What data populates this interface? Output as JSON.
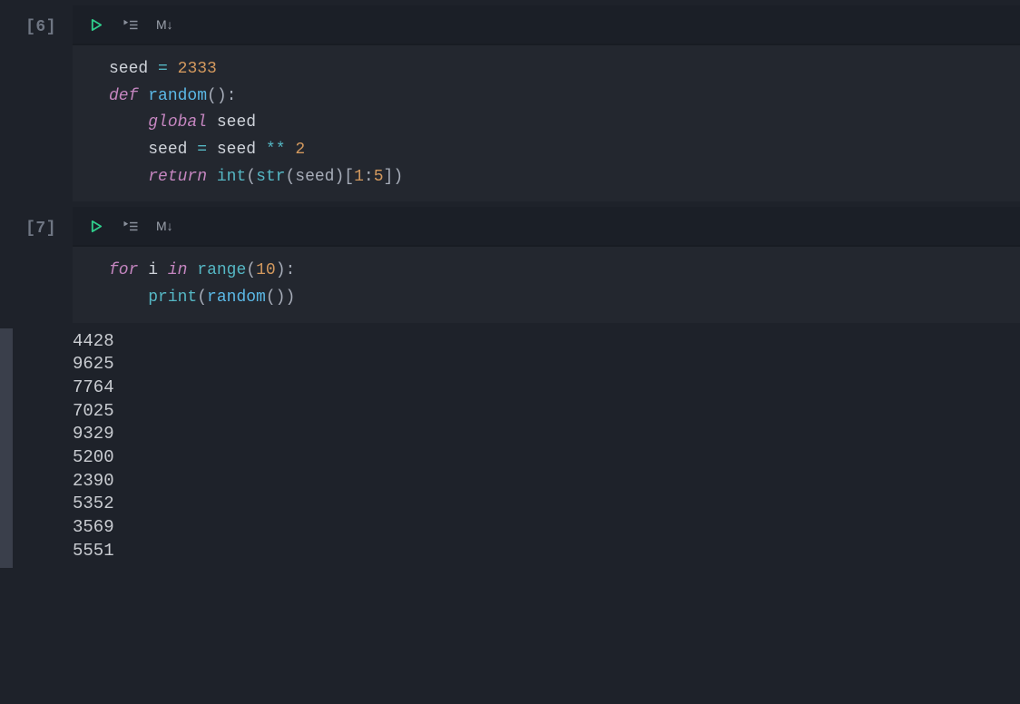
{
  "cells": [
    {
      "prompt": "[6]",
      "toolbar": {
        "markdown_label": "M↓"
      },
      "code_tokens": [
        [
          {
            "t": "seed",
            "c": "tk-id"
          },
          {
            "t": " ",
            "c": ""
          },
          {
            "t": "=",
            "c": "tk-op"
          },
          {
            "t": " ",
            "c": ""
          },
          {
            "t": "2333",
            "c": "tk-num"
          }
        ],
        [
          {
            "t": "def",
            "c": "tk-kw"
          },
          {
            "t": " ",
            "c": ""
          },
          {
            "t": "random",
            "c": "tk-fn"
          },
          {
            "t": "():",
            "c": "tk-punc"
          }
        ],
        [
          {
            "t": "    ",
            "c": ""
          },
          {
            "t": "global",
            "c": "tk-kw2"
          },
          {
            "t": " ",
            "c": ""
          },
          {
            "t": "seed",
            "c": "tk-id"
          }
        ],
        [
          {
            "t": "    ",
            "c": ""
          },
          {
            "t": "seed",
            "c": "tk-id"
          },
          {
            "t": " ",
            "c": ""
          },
          {
            "t": "=",
            "c": "tk-op"
          },
          {
            "t": " ",
            "c": ""
          },
          {
            "t": "seed",
            "c": "tk-id"
          },
          {
            "t": " ",
            "c": ""
          },
          {
            "t": "**",
            "c": "tk-op"
          },
          {
            "t": " ",
            "c": ""
          },
          {
            "t": "2",
            "c": "tk-num"
          }
        ],
        [
          {
            "t": "    ",
            "c": ""
          },
          {
            "t": "return",
            "c": "tk-kw2"
          },
          {
            "t": " ",
            "c": ""
          },
          {
            "t": "int",
            "c": "tk-built"
          },
          {
            "t": "(",
            "c": "tk-punc"
          },
          {
            "t": "str",
            "c": "tk-built"
          },
          {
            "t": "(seed)[",
            "c": "tk-punc"
          },
          {
            "t": "1",
            "c": "tk-num"
          },
          {
            "t": ":",
            "c": "tk-punc"
          },
          {
            "t": "5",
            "c": "tk-num"
          },
          {
            "t": "])",
            "c": "tk-punc"
          }
        ]
      ]
    },
    {
      "prompt": "[7]",
      "toolbar": {
        "markdown_label": "M↓"
      },
      "code_tokens": [
        [
          {
            "t": "for",
            "c": "tk-kw"
          },
          {
            "t": " ",
            "c": ""
          },
          {
            "t": "i",
            "c": "tk-id"
          },
          {
            "t": " ",
            "c": ""
          },
          {
            "t": "in",
            "c": "tk-kw"
          },
          {
            "t": " ",
            "c": ""
          },
          {
            "t": "range",
            "c": "tk-built"
          },
          {
            "t": "(",
            "c": "tk-punc"
          },
          {
            "t": "10",
            "c": "tk-num"
          },
          {
            "t": "):",
            "c": "tk-punc"
          }
        ],
        [
          {
            "t": "    ",
            "c": ""
          },
          {
            "t": "print",
            "c": "tk-built"
          },
          {
            "t": "(",
            "c": "tk-punc"
          },
          {
            "t": "random",
            "c": "tk-fn"
          },
          {
            "t": "())",
            "c": "tk-punc"
          }
        ]
      ],
      "output_lines": [
        "4428",
        "9625",
        "7764",
        "7025",
        "9329",
        "5200",
        "2390",
        "5352",
        "3569",
        "5551"
      ]
    }
  ]
}
